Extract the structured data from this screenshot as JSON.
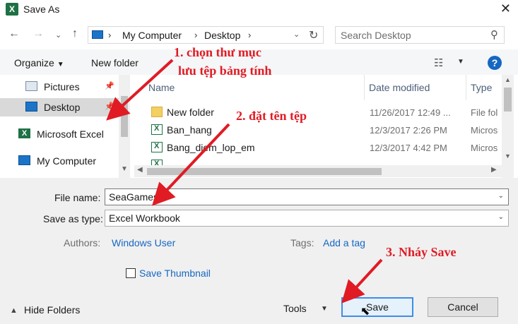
{
  "window": {
    "title": "Save As",
    "app_icon": "X",
    "close_glyph": "✕"
  },
  "nav": {
    "breadcrumb": [
      "My Computer",
      "Desktop"
    ],
    "search_placeholder": "Search Desktop"
  },
  "toolbar": {
    "organize": "Organize",
    "new_folder": "New folder"
  },
  "sidebar": {
    "items": [
      {
        "label": "Pictures",
        "icon": "pictures-icon"
      },
      {
        "label": "Desktop",
        "icon": "desktop-icon",
        "selected": true
      },
      {
        "label": "Microsoft Excel",
        "icon": "excel-icon"
      },
      {
        "label": "My Computer",
        "icon": "computer-icon"
      }
    ]
  },
  "files": {
    "columns": [
      "Name",
      "Date modified",
      "Type"
    ],
    "rows": [
      {
        "name": "New folder",
        "date": "11/26/2017 12:49 ...",
        "type": "File fol",
        "icon": "folder-icon"
      },
      {
        "name": "Ban_hang",
        "date": "12/3/2017 2:26 PM",
        "type": "Micros",
        "icon": "excel-file-icon"
      },
      {
        "name": "Bang_diem_lop_em",
        "date": "12/3/2017 4:42 PM",
        "type": "Micros",
        "icon": "excel-file-icon"
      }
    ]
  },
  "form": {
    "file_name_label": "File name:",
    "file_name_value": "SeaGames",
    "save_type_label": "Save as type:",
    "save_type_value": "Excel Workbook",
    "authors_label": "Authors:",
    "authors_value": "Windows User",
    "tags_label": "Tags:",
    "tags_value": "Add a tag",
    "thumbnail_label": "Save Thumbnail"
  },
  "footer": {
    "hide_folders": "Hide Folders",
    "tools": "Tools",
    "save": "Save",
    "cancel": "Cancel"
  },
  "annotations": {
    "step1_line1": "1. chọn thư mục",
    "step1_line2": "lưu tệp bảng tính",
    "step2": "2. đặt tên tệp",
    "step3": "3. Nháy Save",
    "color": "#e01b24"
  }
}
